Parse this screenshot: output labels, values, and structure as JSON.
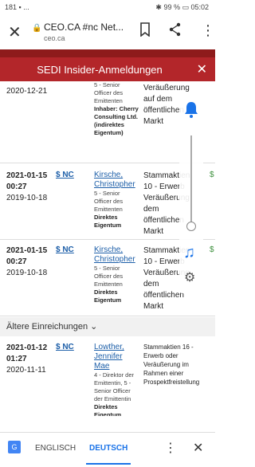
{
  "status": {
    "left": "181 ▪ ...",
    "right": "✱ 99 % ▭ 05:02"
  },
  "browser": {
    "title": "CEO.CA #nc Net...",
    "domain": "ceo.ca"
  },
  "sedi": {
    "title": "SEDI Insider-Anmeldungen"
  },
  "rows": [
    {
      "date_main": "",
      "date_sub": "2020-12-21",
      "symbol": "",
      "insider_name": "",
      "role": "5 - Senior Officer des Emittenten",
      "holder": "Inhaber: Cherry Consulting Ltd. (indirektes Eigentum)",
      "txn": "Veräußerung auf dem öffentlichen Markt",
      "mark": ""
    },
    {
      "date_main": "2021-01-15 00:27",
      "date_sub": "2019-10-18",
      "symbol": "$ NC",
      "insider_name": "Kirsche, Christopher",
      "role": "5 - Senior Officer des Emittenten",
      "holder": "Direktes Eigentum",
      "txn": "Stammaktien 10 - Erwerb Veräußerung dem öffentlichen Markt",
      "mark": "$"
    },
    {
      "date_main": "2021-01-15 00:27",
      "date_sub": "2019-10-18",
      "symbol": "$ NC",
      "insider_name": "Kirsche, Christopher",
      "role": "5 - Senior Officer des Emittenten",
      "holder": "Direktes Eigentum",
      "txn": "Stammaktien 10 - Erwerb Veräußerung dem öffentlichen Markt",
      "mark": "$"
    }
  ],
  "older": {
    "label": "Ältere Einreichungen ⌄"
  },
  "row4": {
    "date_main": "2021-01-12 01:27",
    "date_sub": "2020-11-11",
    "symbol": "$ NC",
    "insider_name": "Lowther, Jennifer Mae",
    "role": "4 - Direktor der Emittentin, 5 - Senior Officer der Emittentin",
    "holder": "Direktes Eigentum",
    "txn": "Stammaktien 16 - Erwerb oder Veräußerung im Rahmen einer Prospektfreistellung"
  },
  "translate": {
    "english": "ENGLISCH",
    "german": "DEUTSCH"
  }
}
